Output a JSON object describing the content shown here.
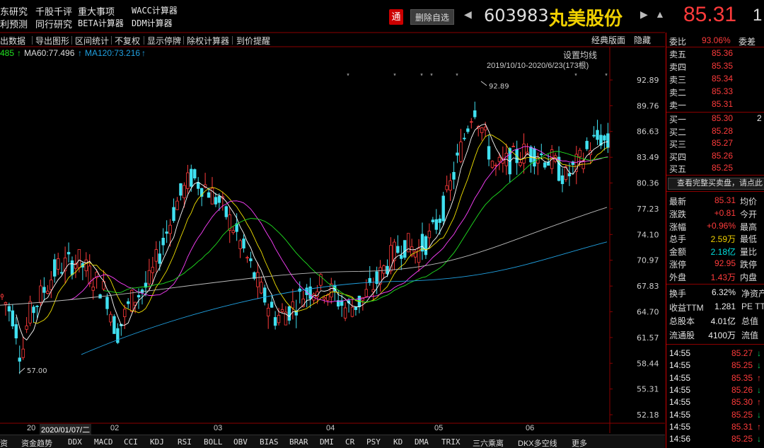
{
  "top_menu": {
    "row1": [
      "东研究",
      "千股千评",
      "重大事项",
      "WACC计算器"
    ],
    "row2": [
      "利预测",
      "同行研究",
      "BETA计算器",
      "DDM计算器"
    ]
  },
  "header": {
    "tong_label": "通",
    "delete_label": "删除自选",
    "code": "603983",
    "name": "丸美股份",
    "price": "85.31",
    "price_clip": "1"
  },
  "toolbar": {
    "items": [
      "出数据",
      "导出图形",
      "区间统计",
      "不复权",
      "显示停牌",
      "除权计算器",
      "到价提醒"
    ],
    "classic": "经典版面",
    "hide": "隐藏"
  },
  "ma_row": {
    "ma_partial": "485",
    "ma60": "MA60:77.496",
    "ma120": "MA120:73.216",
    "set_ma": "设置均线",
    "date_range": "2019/10/10-2020/6/23(173根)"
  },
  "chart_data": {
    "type": "candlestick",
    "y_ticks": [
      "92.89",
      "89.76",
      "86.63",
      "83.49",
      "80.36",
      "77.23",
      "74.10",
      "70.97",
      "67.83",
      "64.70",
      "61.57",
      "58.44",
      "55.31",
      "52.18"
    ],
    "y_range": [
      52.18,
      92.89
    ],
    "x_labels": [
      "20",
      "2020/01/07/二",
      "02",
      "03",
      "04",
      "05",
      "06"
    ],
    "high_label": "92.89",
    "low_label": "57.00",
    "ma_colors": {
      "ma5": "#ffffff",
      "ma10": "#f0e000",
      "ma20": "#ff40ff",
      "ma30": "#20e020",
      "ma60": "#bbbbbb",
      "ma120": "#20a0e0"
    },
    "up_color": "#ff3b3b",
    "down_color": "#40e0f0"
  },
  "bottom_tabs": [
    "资",
    "资金趋势",
    "DDX",
    "MACD",
    "CCI",
    "KDJ",
    "RSI",
    "BOLL",
    "OBV",
    "BIAS",
    "BRAR",
    "DMI",
    "CR",
    "PSY",
    "KD",
    "DMA",
    "TRIX",
    "三六乘离",
    "DKX多空线",
    "更多"
  ],
  "order_book": {
    "weibi_label": "委比",
    "weibi_value": "93.06%",
    "weicha_label": "委差",
    "sells": [
      {
        "label": "卖五",
        "price": "85.36"
      },
      {
        "label": "卖四",
        "price": "85.35"
      },
      {
        "label": "卖三",
        "price": "85.34"
      },
      {
        "label": "卖二",
        "price": "85.33"
      },
      {
        "label": "卖一",
        "price": "85.31"
      }
    ],
    "buys": [
      {
        "label": "买一",
        "price": "85.30",
        "vol": "2"
      },
      {
        "label": "买二",
        "price": "85.28",
        "vol": ""
      },
      {
        "label": "买三",
        "price": "85.27",
        "vol": ""
      },
      {
        "label": "买四",
        "price": "85.26",
        "vol": ""
      },
      {
        "label": "买五",
        "price": "85.25",
        "vol": ""
      }
    ],
    "full_book": "查看完整买卖盘，请点此"
  },
  "quote": [
    {
      "l": "最新",
      "v": "85.31",
      "c": "red",
      "r": "均价"
    },
    {
      "l": "涨跌",
      "v": "+0.81",
      "c": "red",
      "r": "今开"
    },
    {
      "l": "涨幅",
      "v": "+0.96%",
      "c": "red",
      "r": "最高"
    },
    {
      "l": "总手",
      "v": "2.59万",
      "c": "yel",
      "r": "最低"
    },
    {
      "l": "金额",
      "v": "2.18亿",
      "c": "cyn",
      "r": "量比"
    },
    {
      "l": "涨停",
      "v": "92.95",
      "c": "red",
      "r": "跌停"
    },
    {
      "l": "外盘",
      "v": "1.43万",
      "c": "red",
      "r": "内盘"
    }
  ],
  "fundamentals": [
    {
      "l": "换手",
      "v": "6.32%",
      "r": "净资产"
    },
    {
      "l": "收益TTM",
      "v": "1.281",
      "r": "PE TTM"
    },
    {
      "l": "总股本",
      "v": "4.01亿",
      "r": "总值"
    },
    {
      "l": "流通股",
      "v": "4100万",
      "r": "流值"
    }
  ],
  "ticks": [
    {
      "t": "14:55",
      "p": "85.27",
      "c": "grn",
      "a": "↓"
    },
    {
      "t": "14:55",
      "p": "85.25",
      "c": "grn",
      "a": "↓"
    },
    {
      "t": "14:55",
      "p": "85.35",
      "c": "red",
      "a": "↑"
    },
    {
      "t": "14:55",
      "p": "85.26",
      "c": "grn",
      "a": "↓"
    },
    {
      "t": "14:55",
      "p": "85.30",
      "c": "red",
      "a": "↑"
    },
    {
      "t": "14:55",
      "p": "85.25",
      "c": "grn",
      "a": "↓"
    },
    {
      "t": "14:55",
      "p": "85.31",
      "c": "red",
      "a": "↑"
    },
    {
      "t": "14:56",
      "p": "85.25",
      "c": "grn",
      "a": "↓"
    }
  ]
}
